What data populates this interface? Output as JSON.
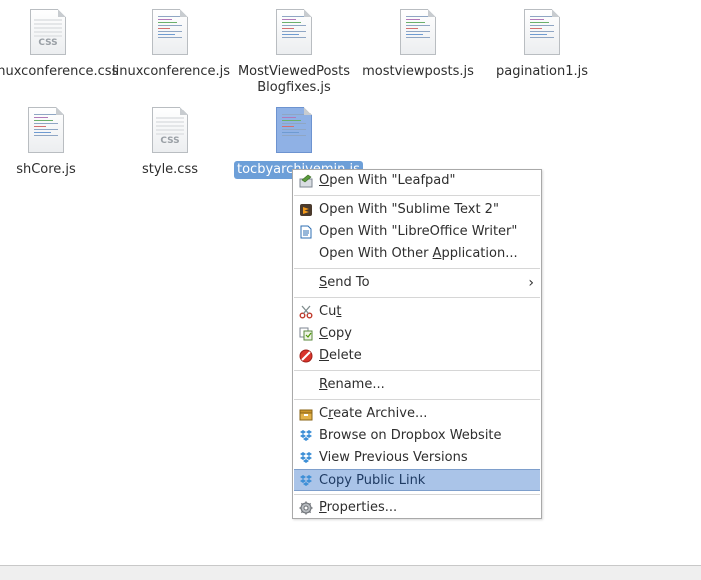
{
  "files": [
    {
      "name": "linuxconference.css",
      "type": "css"
    },
    {
      "name": "linuxconference.js",
      "type": "js"
    },
    {
      "name": "MostViewedPosts\nBlogfixes.js",
      "type": "js"
    },
    {
      "name": "mostviewposts.js",
      "type": "js"
    },
    {
      "name": "pagination1.js",
      "type": "js"
    },
    {
      "name": "shCore.js",
      "type": "js"
    },
    {
      "name": "style.css",
      "type": "css"
    },
    {
      "name": "tocbyarchivemin.js",
      "type": "js",
      "selected": true
    }
  ],
  "icon_css_text": "CSS",
  "context_menu": {
    "open_leafpad": {
      "pre": "",
      "ul": "O",
      "post": "pen With \"Leafpad\"",
      "icon": "leafpad-icon"
    },
    "open_sublime": {
      "label": "Open With \"Sublime Text 2\"",
      "icon": "sublime-icon"
    },
    "open_libreoffice": {
      "label": "Open With \"LibreOffice Writer\"",
      "icon": "libreoffice-writer-icon"
    },
    "open_other": {
      "pre": "Open With Other ",
      "ul": "A",
      "post": "pplication...",
      "icon": "none"
    },
    "send_to": {
      "pre": "",
      "ul": "S",
      "post": "end To",
      "icon": "none",
      "submenu_arrow": "›"
    },
    "cut": {
      "pre": "Cu",
      "ul": "t",
      "post": "",
      "icon": "scissors-icon"
    },
    "copy": {
      "pre": "",
      "ul": "C",
      "post": "opy",
      "icon": "copy-icon"
    },
    "delete": {
      "pre": "",
      "ul": "D",
      "post": "elete",
      "icon": "delete-icon"
    },
    "rename": {
      "pre": "",
      "ul": "R",
      "post": "ename...",
      "icon": "none"
    },
    "create_archive": {
      "pre": "C",
      "ul": "r",
      "post": "eate Archive...",
      "icon": "archive-icon"
    },
    "browse_dropbox": {
      "label": "Browse on Dropbox Website",
      "icon": "dropbox-icon"
    },
    "view_versions": {
      "label": "View Previous Versions",
      "icon": "dropbox-icon"
    },
    "copy_public_link": {
      "label": "Copy Public Link",
      "icon": "dropbox-icon",
      "highlighted": true
    },
    "properties": {
      "pre": "",
      "ul": "P",
      "post": "roperties...",
      "icon": "properties-icon"
    }
  },
  "colors": {
    "selection": "#6d9fd8",
    "menu_highlight": "#aac4e8",
    "dropbox": "#3d8fd6"
  }
}
